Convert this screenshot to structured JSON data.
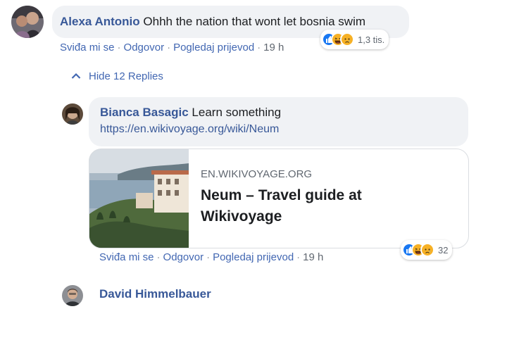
{
  "comment1": {
    "author": "Alexa Antonio",
    "text": "Ohhh the nation that wont let bosnia swim",
    "actions": {
      "like": "Sviđa mi se",
      "reply": "Odgovor",
      "translate": "Pogledaj prijevod",
      "time": "19 h"
    },
    "reactions": {
      "icons": [
        "like-icon",
        "haha-icon",
        "sad-icon"
      ],
      "count": "1,3 tis."
    }
  },
  "replies_toggle": {
    "label": "Hide 12 Replies"
  },
  "reply1": {
    "author": "Bianca Basagic",
    "text": "Learn something",
    "link": "https://en.wikivoyage.org/wiki/Neum",
    "preview": {
      "domain": "EN.WIKIVOYAGE.ORG",
      "title": "Neum – Travel guide at Wikivoyage"
    },
    "actions": {
      "like": "Sviđa mi se",
      "reply": "Odgovor",
      "translate": "Pogledaj prijevod",
      "time": "19 h"
    },
    "reactions": {
      "icons": [
        "like-icon",
        "haha-icon",
        "sad-icon"
      ],
      "count": "32"
    }
  },
  "reply2": {
    "author": "David Himmelbauer"
  },
  "colors": {
    "link": "#385898",
    "action": "#4267b2",
    "bubble": "#f0f2f5",
    "like": "#1877f2",
    "haha": "#f7b125"
  }
}
